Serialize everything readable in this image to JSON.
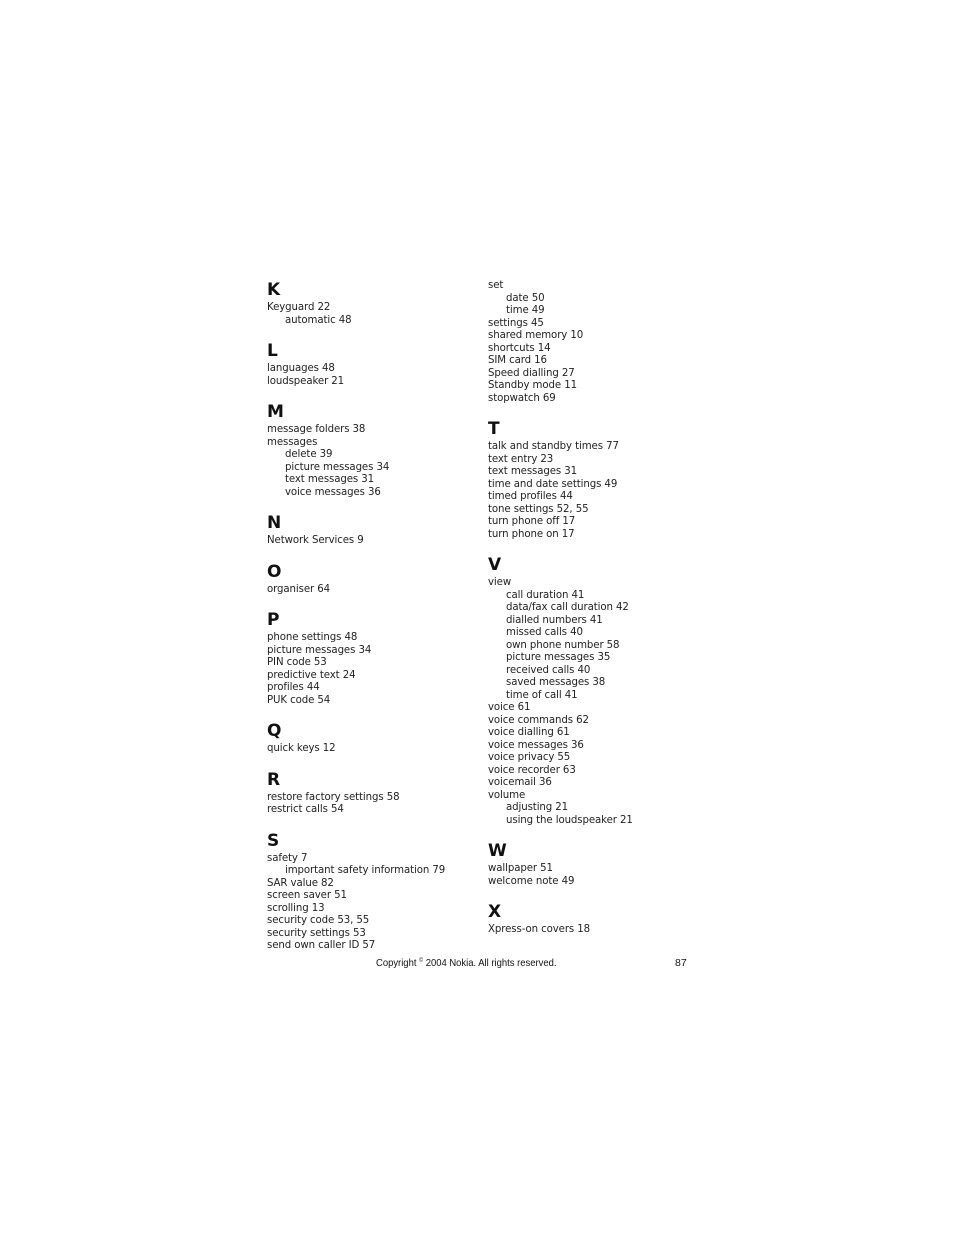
{
  "left_column": [
    {
      "letter": "K",
      "entries": [
        {
          "text": "Keyguard 22",
          "level": 0
        },
        {
          "text": "automatic 48",
          "level": 1
        }
      ]
    },
    {
      "letter": "L",
      "entries": [
        {
          "text": "languages 48",
          "level": 0
        },
        {
          "text": "loudspeaker 21",
          "level": 0
        }
      ]
    },
    {
      "letter": "M",
      "entries": [
        {
          "text": "message folders 38",
          "level": 0
        },
        {
          "text": "messages",
          "level": 0
        },
        {
          "text": "delete 39",
          "level": 1
        },
        {
          "text": "picture messages 34",
          "level": 1
        },
        {
          "text": "text messages 31",
          "level": 1
        },
        {
          "text": "voice messages 36",
          "level": 1
        }
      ]
    },
    {
      "letter": "N",
      "entries": [
        {
          "text": "Network Services 9",
          "level": 0
        }
      ]
    },
    {
      "letter": "O",
      "entries": [
        {
          "text": "organiser 64",
          "level": 0
        }
      ]
    },
    {
      "letter": "P",
      "entries": [
        {
          "text": "phone settings 48",
          "level": 0
        },
        {
          "text": "picture messages 34",
          "level": 0
        },
        {
          "text": "PIN code 53",
          "level": 0
        },
        {
          "text": "predictive text 24",
          "level": 0
        },
        {
          "text": "profiles 44",
          "level": 0
        },
        {
          "text": "PUK code 54",
          "level": 0
        }
      ]
    },
    {
      "letter": "Q",
      "entries": [
        {
          "text": "quick keys 12",
          "level": 0
        }
      ]
    },
    {
      "letter": "R",
      "entries": [
        {
          "text": "restore factory settings 58",
          "level": 0
        },
        {
          "text": "restrict calls 54",
          "level": 0
        }
      ]
    },
    {
      "letter": "S",
      "entries": [
        {
          "text": "safety 7",
          "level": 0
        },
        {
          "text": "important safety information 79",
          "level": 1
        },
        {
          "text": "SAR value 82",
          "level": 0
        },
        {
          "text": "screen saver 51",
          "level": 0
        },
        {
          "text": "scrolling 13",
          "level": 0
        },
        {
          "text": "security code 53, 55",
          "level": 0
        },
        {
          "text": "security settings 53",
          "level": 0
        },
        {
          "text": "send own caller ID 57",
          "level": 0
        }
      ]
    }
  ],
  "right_column": [
    {
      "letter": "",
      "entries": [
        {
          "text": "set",
          "level": 0
        },
        {
          "text": "date 50",
          "level": 1
        },
        {
          "text": "time 49",
          "level": 1
        },
        {
          "text": "settings 45",
          "level": 0
        },
        {
          "text": "shared memory 10",
          "level": 0
        },
        {
          "text": "shortcuts 14",
          "level": 0
        },
        {
          "text": "SIM card 16",
          "level": 0
        },
        {
          "text": "Speed dialling 27",
          "level": 0
        },
        {
          "text": "Standby mode 11",
          "level": 0
        },
        {
          "text": "stopwatch 69",
          "level": 0
        }
      ]
    },
    {
      "letter": "T",
      "entries": [
        {
          "text": "talk and standby times 77",
          "level": 0
        },
        {
          "text": "text entry 23",
          "level": 0
        },
        {
          "text": "text messages 31",
          "level": 0
        },
        {
          "text": "time and date settings 49",
          "level": 0
        },
        {
          "text": "timed profiles 44",
          "level": 0
        },
        {
          "text": "tone settings 52, 55",
          "level": 0
        },
        {
          "text": "turn phone off 17",
          "level": 0
        },
        {
          "text": "turn phone on 17",
          "level": 0
        }
      ]
    },
    {
      "letter": "V",
      "entries": [
        {
          "text": "view",
          "level": 0
        },
        {
          "text": "call duration 41",
          "level": 1
        },
        {
          "text": "data/fax call duration 42",
          "level": 1
        },
        {
          "text": "dialled numbers 41",
          "level": 1
        },
        {
          "text": "missed calls 40",
          "level": 1
        },
        {
          "text": "own phone number 58",
          "level": 1
        },
        {
          "text": "picture messages 35",
          "level": 1
        },
        {
          "text": "received calls 40",
          "level": 1
        },
        {
          "text": "saved messages 38",
          "level": 1
        },
        {
          "text": "time of call 41",
          "level": 1
        },
        {
          "text": "voice 61",
          "level": 0
        },
        {
          "text": "voice commands 62",
          "level": 0
        },
        {
          "text": "voice dialling 61",
          "level": 0
        },
        {
          "text": "voice messages 36",
          "level": 0
        },
        {
          "text": "voice privacy 55",
          "level": 0
        },
        {
          "text": "voice recorder 63",
          "level": 0
        },
        {
          "text": "voicemail 36",
          "level": 0
        },
        {
          "text": "volume",
          "level": 0
        },
        {
          "text": "adjusting 21",
          "level": 1
        },
        {
          "text": "using the loudspeaker 21",
          "level": 1
        }
      ]
    },
    {
      "letter": "W",
      "entries": [
        {
          "text": "wallpaper 51",
          "level": 0
        },
        {
          "text": "welcome note 49",
          "level": 0
        }
      ]
    },
    {
      "letter": "X",
      "entries": [
        {
          "text": "Xpress-on covers 18",
          "level": 0
        }
      ]
    }
  ],
  "footer": {
    "copyright_prefix": "Copyright",
    "copyright_symbol": "©",
    "copyright_suffix": "2004 Nokia. All rights reserved.",
    "page_number": "87"
  }
}
